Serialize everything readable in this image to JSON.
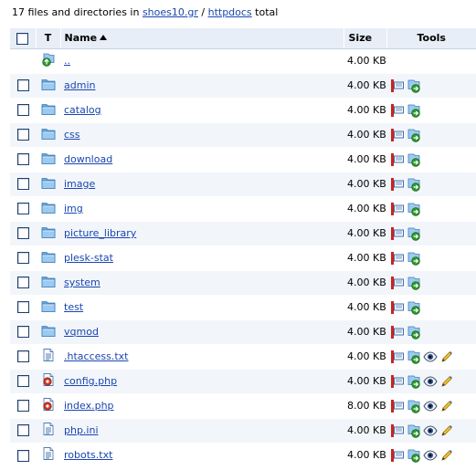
{
  "summary": {
    "prefix": "17 files and directories in ",
    "path_parts": [
      "shoes10.gr",
      "httpdocs"
    ],
    "separator": " / ",
    "suffix": " total"
  },
  "columns": {
    "type": "T",
    "name": "Name",
    "size": "Size",
    "tools": "Tools"
  },
  "rows": [
    {
      "name": "..",
      "size": "4.00 KB",
      "kind": "up",
      "checkbox": false,
      "tools": []
    },
    {
      "name": "admin",
      "size": "4.00 KB",
      "kind": "folder",
      "checkbox": true,
      "tools": [
        "permissions",
        "rename"
      ]
    },
    {
      "name": "catalog",
      "size": "4.00 KB",
      "kind": "folder",
      "checkbox": true,
      "tools": [
        "permissions",
        "rename"
      ]
    },
    {
      "name": "css",
      "size": "4.00 KB",
      "kind": "folder",
      "checkbox": true,
      "tools": [
        "permissions",
        "rename"
      ]
    },
    {
      "name": "download",
      "size": "4.00 KB",
      "kind": "folder",
      "checkbox": true,
      "tools": [
        "permissions",
        "rename"
      ]
    },
    {
      "name": "image",
      "size": "4.00 KB",
      "kind": "folder",
      "checkbox": true,
      "tools": [
        "permissions",
        "rename"
      ]
    },
    {
      "name": "img",
      "size": "4.00 KB",
      "kind": "folder",
      "checkbox": true,
      "tools": [
        "permissions",
        "rename"
      ]
    },
    {
      "name": "picture_library",
      "size": "4.00 KB",
      "kind": "folder",
      "checkbox": true,
      "tools": [
        "permissions",
        "rename"
      ]
    },
    {
      "name": "plesk-stat",
      "size": "4.00 KB",
      "kind": "folder",
      "checkbox": true,
      "tools": [
        "permissions",
        "rename"
      ]
    },
    {
      "name": "system",
      "size": "4.00 KB",
      "kind": "folder",
      "checkbox": true,
      "tools": [
        "permissions",
        "rename"
      ]
    },
    {
      "name": "test",
      "size": "4.00 KB",
      "kind": "folder",
      "checkbox": true,
      "tools": [
        "permissions",
        "rename"
      ]
    },
    {
      "name": "vqmod",
      "size": "4.00 KB",
      "kind": "folder",
      "checkbox": true,
      "tools": [
        "permissions",
        "rename"
      ]
    },
    {
      "name": ".htaccess.txt",
      "size": "4.00 KB",
      "kind": "text",
      "checkbox": true,
      "tools": [
        "permissions",
        "rename",
        "view",
        "edit"
      ]
    },
    {
      "name": "config.php",
      "size": "4.00 KB",
      "kind": "php",
      "checkbox": true,
      "tools": [
        "permissions",
        "rename",
        "view",
        "edit"
      ]
    },
    {
      "name": "index.php",
      "size": "8.00 KB",
      "kind": "php",
      "checkbox": true,
      "tools": [
        "permissions",
        "rename",
        "view",
        "edit"
      ]
    },
    {
      "name": "php.ini",
      "size": "4.00 KB",
      "kind": "text",
      "checkbox": true,
      "tools": [
        "permissions",
        "rename",
        "view",
        "edit"
      ]
    },
    {
      "name": "robots.txt",
      "size": "4.00 KB",
      "kind": "text",
      "checkbox": true,
      "tools": [
        "permissions",
        "rename",
        "view",
        "edit"
      ]
    }
  ],
  "colors": {
    "link": "#1a46b0",
    "header_bg": "#e7eef7",
    "row_alt_bg": "#f2f6fb",
    "folder": "#8ec1ec",
    "checkbox_border": "#1c3d6b"
  }
}
